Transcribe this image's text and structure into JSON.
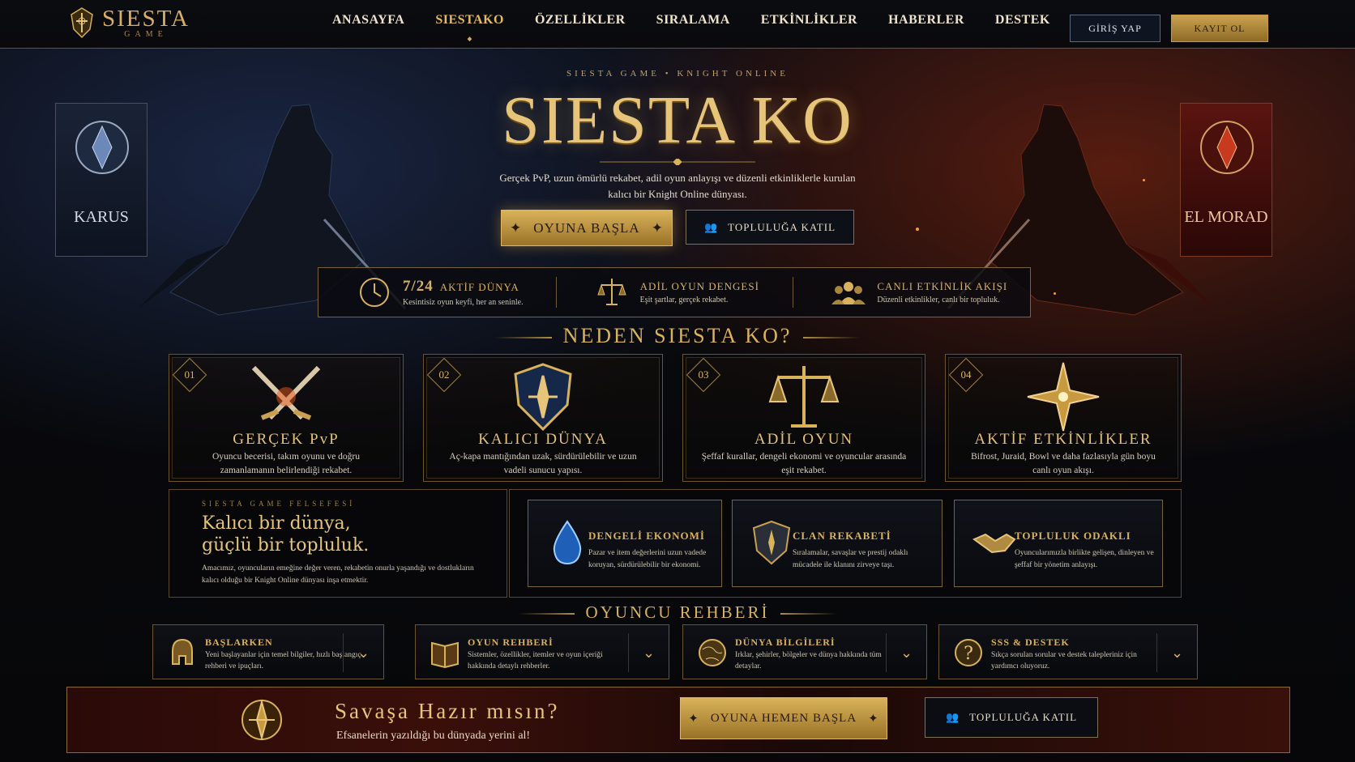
{
  "brand": {
    "name": "SIESTA",
    "sub": "GAME"
  },
  "nav": [
    "ANASAYFA",
    "SIESTAKO",
    "ÖZELLİKLER",
    "SIRALAMA",
    "ETKİNLİKLER",
    "HABERLER",
    "DESTEK"
  ],
  "nav_active": "SIESTAKO",
  "auth": {
    "login": "GİRİŞ YAP",
    "register": "KAYIT OL"
  },
  "hero": {
    "kicker": "SIESTA GAME • KNIGHT ONLINE",
    "title": "SIESTA KO",
    "desc": "Gerçek PvP, uzun ömürlü rekabet, adil oyun anlayışı ve düzenli etkinliklerle kurulan kalıcı bir Knight Online dünyası.",
    "cta_primary": "OYUNA BAŞLA",
    "cta_secondary": "TOPLULUĞA KATIL",
    "left_banner": "KARUS",
    "right_banner": "EL MORAD"
  },
  "stats": [
    {
      "value": "7/24",
      "label": "AKTİF DÜNYA",
      "sub": "Kesintisiz oyun keyfi, her an seninle.",
      "icon": "clock-icon"
    },
    {
      "value": "",
      "label": "ADİL OYUN DENGESİ",
      "sub": "Eşit şartlar, gerçek rekabet.",
      "icon": "scales-icon"
    },
    {
      "value": "",
      "label": "CANLI ETKİNLİK AKIŞI",
      "sub": "Düzenli etkinlikler, canlı bir topluluk.",
      "icon": "community-icon"
    }
  ],
  "why": {
    "heading": "NEDEN SIESTA KO?",
    "cards": [
      {
        "num": "01",
        "title": "GERÇEK PvP",
        "text": "Oyuncu becerisi, takım oyunu ve doğru zamanlamanın belirlendiği rekabet.",
        "icon": "crossed-swords-icon"
      },
      {
        "num": "02",
        "title": "KALICI DÜNYA",
        "text": "Aç-kapa mantığından uzak, sürdürülebilir ve uzun vadeli sunucu yapısı.",
        "icon": "shield-icon"
      },
      {
        "num": "03",
        "title": "ADİL OYUN",
        "text": "Şeffaf kurallar, dengeli ekonomi ve oyuncular arasında eşit rekabet.",
        "icon": "scales-icon"
      },
      {
        "num": "04",
        "title": "AKTİF ETKİNLİKLER",
        "text": "Bifrost, Juraid, Bowl ve daha fazlasıyla gün boyu canlı oyun akışı.",
        "icon": "star-icon"
      }
    ]
  },
  "philosophy": {
    "kicker": "SIESTA GAME FELSEFESİ",
    "title_line1": "Kalıcı bir dünya,",
    "title_line2": "güçlü bir topluluk.",
    "text": "Amacımız, oyuncuların emeğine değer veren, rekabetin onurla yaşandığı ve dostlukların kalıcı olduğu bir Knight Online dünyası inşa etmektir."
  },
  "features": [
    {
      "title": "DENGELİ EKONOMİ",
      "text": "Pazar ve item değerlerini uzun vadede koruyan, sürdürülebilir bir ekonomi.",
      "icon": "droplet-icon"
    },
    {
      "title": "CLAN REKABETİ",
      "text": "Sıralamalar, savaşlar ve prestij odaklı mücadele ile klanını zirveye taşı.",
      "icon": "shield-icon"
    },
    {
      "title": "TOPLULUK ODAKLI",
      "text": "Oyuncularımızla birlikte gelişen, dinleyen ve şeffaf bir yönetim anlayışı.",
      "icon": "handshake-icon"
    }
  ],
  "guide": {
    "heading": "OYUNCU REHBERİ",
    "items": [
      {
        "title": "BAŞLARKEN",
        "text": "Yeni başlayanlar için temel bilgiler, hızlı başlangıç rehberi ve ipuçları.",
        "icon": "helmet-icon"
      },
      {
        "title": "OYUN REHBERİ",
        "text": "Sistemler, özellikler, itemler ve oyun içeriği hakkında detaylı rehberler.",
        "icon": "book-icon"
      },
      {
        "title": "DÜNYA BİLGİLERİ",
        "text": "Irklar, şehirler, bölgeler ve dünya hakkında tüm detaylar.",
        "icon": "globe-icon"
      },
      {
        "title": "SSS & DESTEK",
        "text": "Sıkça sorulan sorular ve destek talepleriniz için yardımcı oluyoruz.",
        "icon": "question-icon"
      }
    ]
  },
  "final": {
    "title": "Savaşa Hazır mısın?",
    "sub": "Efsanelerin yazıldığı bu dünyada yerini al!",
    "cta_primary": "OYUNA HEMEN BAŞLA",
    "cta_secondary": "TOPLULUĞA KATIL"
  },
  "colors": {
    "gold": "#d9b25c",
    "karus": "#1a2336",
    "elmorad": "#5a1410"
  }
}
